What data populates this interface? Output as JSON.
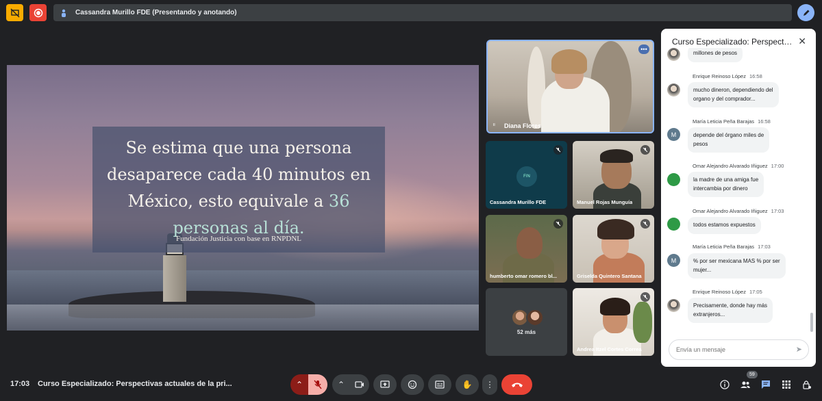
{
  "topbar": {
    "presenting_text": "Cassandra Murillo FDE (Presentando y anotando)"
  },
  "slide": {
    "line1": "Se estima que una persona",
    "line2": "desaparece cada 40 minutos en",
    "line3_a": "México, esto equivale a ",
    "line3_b": "36",
    "line4": "personas al día.",
    "source": "Fundación Justicia con base en RNPDNL"
  },
  "tiles": {
    "diana": "Diana Flores",
    "cassandra": "Cassandra Murillo FDE",
    "cassandra_logo": "FIN",
    "manuel": "Manuel Rojas Munguía",
    "humberto": "humberto omar romero bl...",
    "griselda": "Griselda Quintero Santana",
    "more_label": "52 más",
    "andrea": "Andrea Itzel Cortes Correa"
  },
  "chat": {
    "title": "Curso Especializado: Perspectiva...",
    "partial_top": "millones de pesos",
    "messages": [
      {
        "author": "Enrique Reinoso López",
        "time": "16:58",
        "line1": "mucho dineron, dependiendo del",
        "line2": "organo y del comprador..."
      },
      {
        "author": "María Leticia Peña Barajas",
        "time": "16:58",
        "line1": "depende del órgano miles de",
        "line2": "pesos"
      },
      {
        "author": "Omar Alejandro Alvarado Iñiguez",
        "time": "17:00",
        "line1": "la madre de una amiga fue",
        "line2": "intercambia por dinero"
      },
      {
        "author": "Omar Alejandro Alvarado Iñiguez",
        "time": "17:03",
        "line1": "todos estamos expuestos",
        "line2": ""
      },
      {
        "author": "María Leticia Peña Barajas",
        "time": "17:03",
        "line1": "% por ser mexicana MAS % por ser",
        "line2": "mujer..."
      },
      {
        "author": "Enrique Reinoso López",
        "time": "17:05",
        "line1": "Precisamente, donde hay más",
        "line2": "extranjeros..."
      }
    ],
    "avatar_m": "M",
    "input_placeholder": "Envía un mensaje"
  },
  "bottombar": {
    "clock": "17:03",
    "meeting_title": "Curso Especializado: Perspectivas actuales de la pri...",
    "participants_count": "59"
  },
  "colors": {
    "accent": "#8ab4f8",
    "end_call": "#ea4335",
    "mic_off_bg": "#f6aea9",
    "chat_green": "#2e9a46"
  }
}
